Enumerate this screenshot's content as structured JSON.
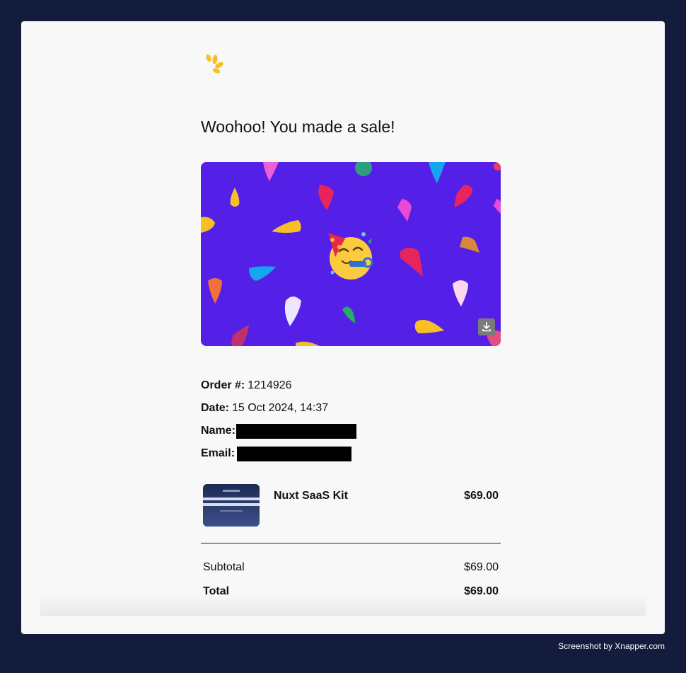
{
  "email": {
    "headline": "Woohoo! You made a sale!",
    "hero_image": "party-celebration-emoji-banner",
    "order": {
      "order_label": "Order #:",
      "order_number": "1214926",
      "date_label": "Date:",
      "date_value": "15 Oct 2024, 14:37",
      "name_label": "Name:",
      "email_label": "Email:"
    },
    "product": {
      "name": "Nuxt SaaS Kit",
      "price": "$69.00",
      "thumb_lines": [
        "h your Robust and Market-",
        "t in Weeks and start earning"
      ]
    },
    "totals": {
      "subtotal_label": "Subtotal",
      "subtotal_value": "$69.00",
      "total_label": "Total",
      "total_value": "$69.00"
    }
  },
  "footer": {
    "credit": "Screenshot by Xnapper.com"
  },
  "colors": {
    "page_background": "#141c3d",
    "card_background": "#f8f8f8",
    "hero_background": "#5420e8",
    "logo_yellow": "#f6bf26"
  },
  "icons": [
    "logo-icon",
    "party-face-emoji-icon",
    "download-icon"
  ]
}
